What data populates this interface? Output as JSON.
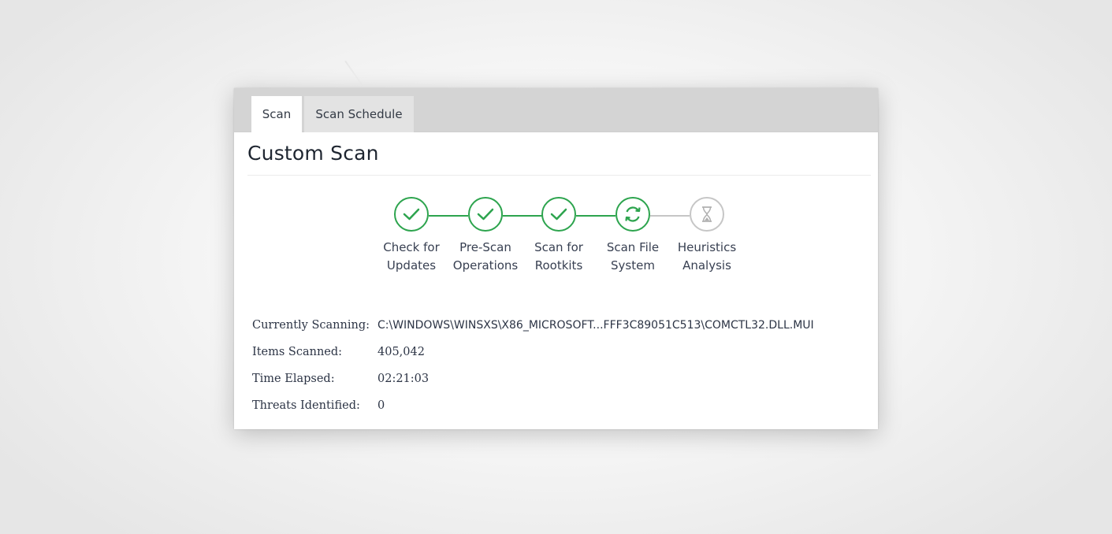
{
  "tabs": [
    {
      "label": "Scan",
      "active": true
    },
    {
      "label": "Scan Schedule",
      "active": false
    }
  ],
  "page_title": "Custom Scan",
  "colors": {
    "complete": "#2da44e",
    "pending": "#c6c6c6"
  },
  "steps": [
    {
      "line1": "Check for",
      "line2": "Updates",
      "status": "complete",
      "icon": "check-icon"
    },
    {
      "line1": "Pre-Scan",
      "line2": "Operations",
      "status": "complete",
      "icon": "check-icon"
    },
    {
      "line1": "Scan for",
      "line2": "Rootkits",
      "status": "complete",
      "icon": "check-icon"
    },
    {
      "line1": "Scan File",
      "line2": "System",
      "status": "in-progress",
      "icon": "sync-icon"
    },
    {
      "line1": "Heuristics",
      "line2": "Analysis",
      "status": "pending",
      "icon": "hourglass-icon"
    }
  ],
  "details": {
    "currently_scanning_label": "Currently Scanning:",
    "currently_scanning_value": "C:\\WINDOWS\\WINSXS\\X86_MICROSOFT...FFF3C89051C513\\COMCTL32.DLL.MUI",
    "items_scanned_label": "Items Scanned:",
    "items_scanned_value": "405,042",
    "time_elapsed_label": "Time Elapsed:",
    "time_elapsed_value": "02:21:03",
    "threats_label": "Threats Identified:",
    "threats_value": "0"
  }
}
